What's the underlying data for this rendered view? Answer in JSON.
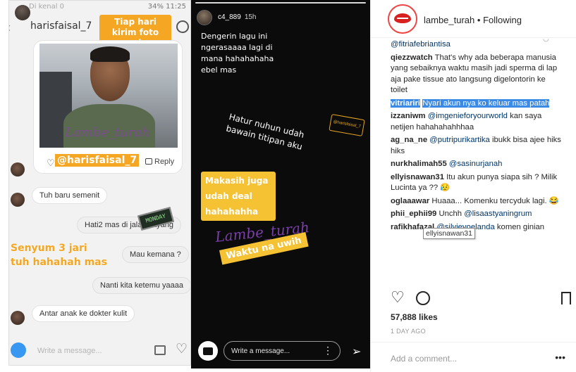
{
  "dm": {
    "status_left": "Di kenal 0",
    "status_right": "34%  11:25",
    "username": "harisfaisal_7",
    "sticker_top": "Tiap hari kirim foto mulu",
    "photo_watermark": "Lambe_turah",
    "mention": "@harisfaisal_7",
    "reply_label": "Reply",
    "messages": [
      "Tuh baru semenit",
      "Hati2 mas di jalan sayang",
      "Mau kemana ?",
      "Nanti kita ketemu yaaaa",
      "Antar anak ke dokter kulit"
    ],
    "sticker_monday": "MONDAY",
    "senyum_caption": "Senyum 3 jari tuh hahahah mas",
    "input_placeholder": "Write a message..."
  },
  "story": {
    "username": "c4_889",
    "time": "15h",
    "text1": "Dengerin lagu ini ngerasaaaa lagi di mana hahahahaha ebel mas",
    "text2": "Hatur nuhun udah bawain titipan aku",
    "tag_sticker": "@harisfaisal_7",
    "makasih": "Makasih juga udah deal hahahahha",
    "watermark": "Lambe_turah",
    "waktu": "Waktu na uwih",
    "input_placeholder": "Write a message..."
  },
  "post": {
    "username": "lambe_turah",
    "follow_state": "Following",
    "comments": [
      {
        "mention": "@fitriafebriantisa"
      },
      {
        "user": "qiezzwatch",
        "text": "That's why ada beberapa manusia yang sebaiknya waktu masih jadi sperma di lap aja pake tissue ato langsung digelontorin ke toilet"
      },
      {
        "user": "vitriariri",
        "text": "Nyari akun nya ko keluar mas patah"
      },
      {
        "user": "izzaniwm",
        "mention": "@imgenieforyourworld",
        "text": "kan saya netijen hahahahahhhaa"
      },
      {
        "user": "ag_na_ne",
        "mention": "@putripurikartika",
        "text": "ibukk bisa ajee hiks hiks"
      },
      {
        "user": "nurkhalimah55",
        "mention": "@sasinurjanah"
      },
      {
        "user": "ellyisnawan31",
        "text": "Itu akun punya siapa sih ? Milik Lucinta ya ?? 😥"
      },
      {
        "user": "oglaaawar",
        "text": "Huaaa... Komenku tercyduk lagi. 😂"
      },
      {
        "user": "phii_ephii99",
        "text": "Unchh",
        "mention": "@lisaastyaningrum"
      },
      {
        "user": "rafikhafazal",
        "mention": "@silvieyoelanda",
        "text": "komen ginian"
      }
    ],
    "tooltip": "ellyisnawan31",
    "likes": "57,888 likes",
    "time_ago": "1 DAY AGO",
    "add_comment_placeholder": "Add a comment..."
  },
  "colors": {
    "accent_orange": "#f5a623",
    "highlight_blue": "#3a8ae6",
    "mention_blue": "#003569",
    "story_bg": "#0b0b0b"
  }
}
